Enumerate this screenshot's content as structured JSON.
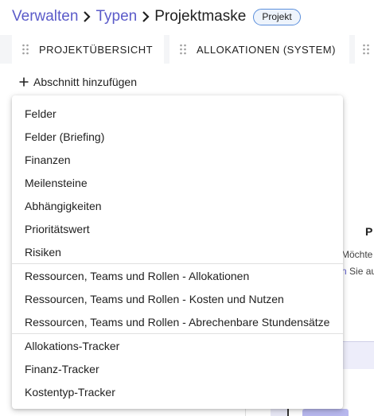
{
  "breadcrumb": {
    "items": [
      "Verwalten",
      "Typen"
    ],
    "current": "Projektmaske",
    "badge": "Projekt"
  },
  "tabs": [
    {
      "label": "PROJEKTÜBERSICHT"
    },
    {
      "label": "ALLOKATIONEN (SYSTEM)"
    }
  ],
  "add_section": {
    "label": "Abschnitt hinzufügen"
  },
  "background": {
    "heading_fragment": "P",
    "text_fragment_1": "Möchte",
    "text_fragment_2_link": "n",
    "text_fragment_2": " Sie au"
  },
  "menu": {
    "items": [
      {
        "label": "Felder"
      },
      {
        "label": "Felder (Briefing)"
      },
      {
        "label": "Finanzen"
      },
      {
        "label": "Meilensteine"
      },
      {
        "label": "Abhängigkeiten"
      },
      {
        "label": "Prioritätswert"
      },
      {
        "label": "Risiken"
      },
      {
        "label": "Ressourcen, Teams und Rollen - Allokationen"
      },
      {
        "label": "Ressourcen, Teams und Rollen - Kosten und Nutzen"
      },
      {
        "label": "Ressourcen, Teams und Rollen - Abrechenbare Stundensätze"
      },
      {
        "label": "Allokations-Tracker"
      },
      {
        "label": "Finanz-Tracker"
      },
      {
        "label": "Kostentyp-Tracker"
      }
    ]
  },
  "colors": {
    "link": "#5b5bc9",
    "badge_border": "#5b8fdc",
    "tabs_bg": "#f4f5f7"
  }
}
